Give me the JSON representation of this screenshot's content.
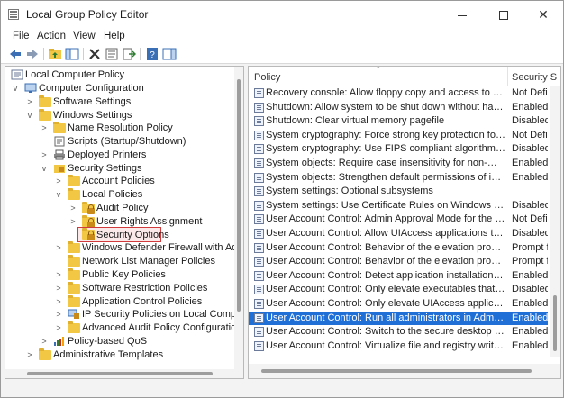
{
  "window": {
    "title": "Local Group Policy Editor"
  },
  "menu": [
    "File",
    "Action",
    "View",
    "Help"
  ],
  "toolbar": [
    "back-icon",
    "forward-icon",
    "up-folder-icon",
    "show-hide-tree-icon",
    "delete-icon",
    "properties-icon",
    "export-list-icon",
    "help-icon",
    "show-pane-icon"
  ],
  "tree": [
    {
      "label": "Local Computer Policy",
      "icon": "computer-policy-icon",
      "expander": ""
    },
    {
      "label": "Computer Configuration",
      "icon": "computer-icon",
      "expander": "v"
    },
    {
      "label": "Software Settings",
      "icon": "folder-icon",
      "expander": ">"
    },
    {
      "label": "Windows Settings",
      "icon": "folder-icon",
      "expander": "v"
    },
    {
      "label": "Name Resolution Policy",
      "icon": "folder-icon",
      "expander": ">"
    },
    {
      "label": "Scripts (Startup/Shutdown)",
      "icon": "scripts-icon",
      "expander": ""
    },
    {
      "label": "Deployed Printers",
      "icon": "printer-icon",
      "expander": ">"
    },
    {
      "label": "Security Settings",
      "icon": "security-icon",
      "expander": "v"
    },
    {
      "label": "Account Policies",
      "icon": "folder-icon",
      "expander": ">"
    },
    {
      "label": "Local Policies",
      "icon": "folder-icon",
      "expander": "v"
    },
    {
      "label": "Audit Policy",
      "icon": "folder-icon",
      "expander": ">"
    },
    {
      "label": "User Rights Assignment",
      "icon": "folder-icon",
      "expander": ">"
    },
    {
      "label": "Security Options",
      "icon": "folder-lock-icon",
      "expander": ""
    },
    {
      "label": "Windows Defender Firewall with Advanc",
      "icon": "folder-icon",
      "expander": ">"
    },
    {
      "label": "Network List Manager Policies",
      "icon": "folder-icon",
      "expander": ""
    },
    {
      "label": "Public Key Policies",
      "icon": "folder-icon",
      "expander": ">"
    },
    {
      "label": "Software Restriction Policies",
      "icon": "folder-icon",
      "expander": ">"
    },
    {
      "label": "Application Control Policies",
      "icon": "folder-icon",
      "expander": ">"
    },
    {
      "label": "IP Security Policies on Local Computer",
      "icon": "ip-security-icon",
      "expander": ">"
    },
    {
      "label": "Advanced Audit Policy Configuration",
      "icon": "folder-icon",
      "expander": ">"
    },
    {
      "label": "Policy-based QoS",
      "icon": "qos-chart-icon",
      "expander": ">"
    },
    {
      "label": "Administrative Templates",
      "icon": "folder-icon",
      "expander": ">"
    }
  ],
  "list": {
    "headers": {
      "policy": "Policy",
      "setting": "Security S"
    },
    "rows": [
      {
        "policy": "Recovery console: Allow floppy copy and access to all drives a...",
        "setting": "Not Defin"
      },
      {
        "policy": "Shutdown: Allow system to be shut down without having to l...",
        "setting": "Enabled"
      },
      {
        "policy": "Shutdown: Clear virtual memory pagefile",
        "setting": "Disabled"
      },
      {
        "policy": "System cryptography: Force strong key protection for user ke...",
        "setting": "Not Defin"
      },
      {
        "policy": "System cryptography: Use FIPS compliant algorithms for encr...",
        "setting": "Disabled"
      },
      {
        "policy": "System objects: Require case insensitivity for non-Windows s...",
        "setting": "Enabled"
      },
      {
        "policy": "System objects: Strengthen default permissions of internal sy...",
        "setting": "Enabled"
      },
      {
        "policy": "System settings: Optional subsystems",
        "setting": ""
      },
      {
        "policy": "System settings: Use Certificate Rules on Windows Executable...",
        "setting": "Disabled"
      },
      {
        "policy": "User Account Control: Admin Approval Mode for the Built-in ...",
        "setting": "Not Defin"
      },
      {
        "policy": "User Account Control: Allow UIAccess applications to prompt ...",
        "setting": "Disabled"
      },
      {
        "policy": "User Account Control: Behavior of the elevation prompt for a...",
        "setting": "Prompt fo"
      },
      {
        "policy": "User Account Control: Behavior of the elevation prompt for st...",
        "setting": "Prompt fo"
      },
      {
        "policy": "User Account Control: Detect application installations and pr...",
        "setting": "Enabled"
      },
      {
        "policy": "User Account Control: Only elevate executables that are signe...",
        "setting": "Disabled"
      },
      {
        "policy": "User Account Control: Only elevate UIAccess applications that...",
        "setting": "Enabled"
      },
      {
        "policy": "User Account Control: Run all administrators in Admin Appro...",
        "setting": "Enabled",
        "selected": true
      },
      {
        "policy": "User Account Control: Switch to the secure desktop when pro...",
        "setting": "Enabled"
      },
      {
        "policy": "User Account Control: Virtualize file and registry write failures...",
        "setting": "Enabled"
      }
    ]
  },
  "colors": {
    "selection": "#1f6fd6",
    "highlight_border": "#d23b3b"
  }
}
